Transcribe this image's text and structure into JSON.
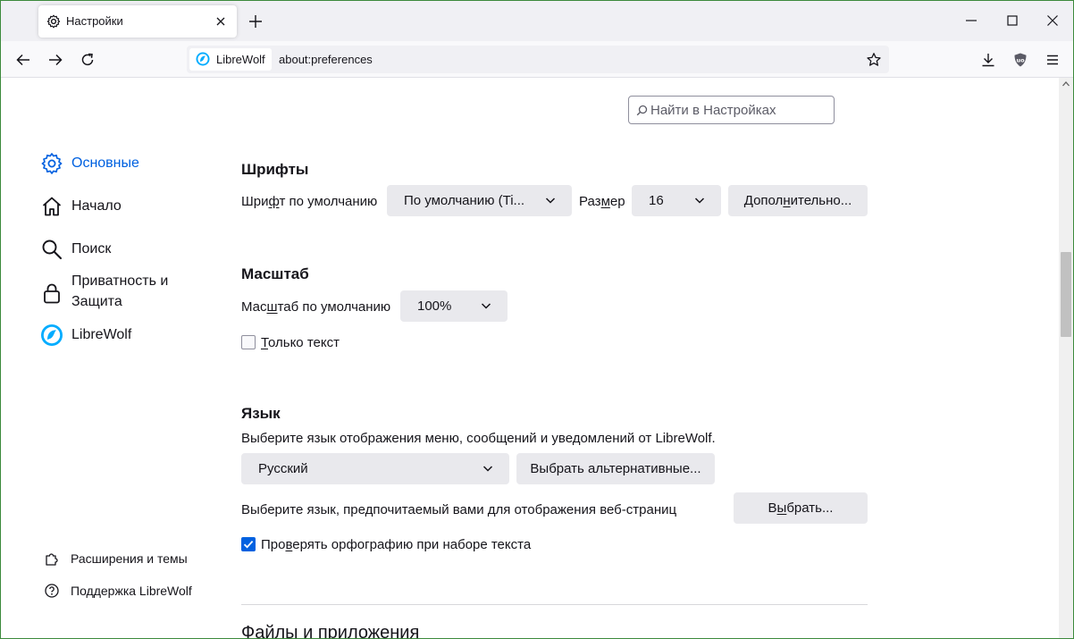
{
  "tab": {
    "title": "Настройки"
  },
  "urlbar": {
    "identity_label": "LibreWolf",
    "url": "about:preferences"
  },
  "search": {
    "placeholder": "Найти в Настройках"
  },
  "sidebar": {
    "categories": [
      {
        "label": "Основные",
        "icon": "gear-icon",
        "selected": true
      },
      {
        "label": "Начало",
        "icon": "home-icon",
        "selected": false
      },
      {
        "label": "Поиск",
        "icon": "search-icon",
        "selected": false
      },
      {
        "label": "Приватность и Защита",
        "line1": "Приватность и",
        "line2": "Защита",
        "icon": "lock-icon",
        "selected": false
      },
      {
        "label": "LibreWolf",
        "icon": "librewolf-icon",
        "selected": false
      }
    ],
    "footer": [
      {
        "label": "Расширения и темы",
        "icon": "puzzle-icon"
      },
      {
        "label": "Поддержка LibreWolf",
        "icon": "help-icon"
      }
    ]
  },
  "fonts": {
    "heading": "Шрифты",
    "default_font_label_pre": "Шри",
    "default_font_label_u": "ф",
    "default_font_label_post": "т по умолчанию",
    "default_font_value": "По умолчанию (Ti...",
    "size_label_pre": "Раз",
    "size_label_u": "м",
    "size_label_post": "ер",
    "size_value": "16",
    "advanced_pre": "Допол",
    "advanced_u": "н",
    "advanced_post": "ительно..."
  },
  "zoom": {
    "heading": "Масштаб",
    "default_zoom_label_pre": "Мас",
    "default_zoom_label_u": "ш",
    "default_zoom_label_post": "таб по умолчанию",
    "default_zoom_value": "100%",
    "text_only_pre": "",
    "text_only_u": "Т",
    "text_only_post": "олько текст",
    "text_only_checked": false
  },
  "language": {
    "heading": "Язык",
    "description": "Выберите язык отображения меню, сообщений и уведомлений от LibreWolf.",
    "selected_language": "Русский",
    "alternatives_button": "Выбрать альтернативные...",
    "web_lang_label": "Выберите язык, предпочитаемый вами для отображения веб-страниц",
    "choose_pre": "В",
    "choose_u": "ы",
    "choose_post": "брать...",
    "spellcheck_pre": "Про",
    "spellcheck_u": "в",
    "spellcheck_post": "ерять орфографию при наборе текста",
    "spellcheck_checked": true
  },
  "files": {
    "heading": "Файлы и приложения"
  },
  "colors": {
    "accent": "#0061e0",
    "window_border": "#3c8a3c",
    "button_bg": "#e9e9ed"
  }
}
